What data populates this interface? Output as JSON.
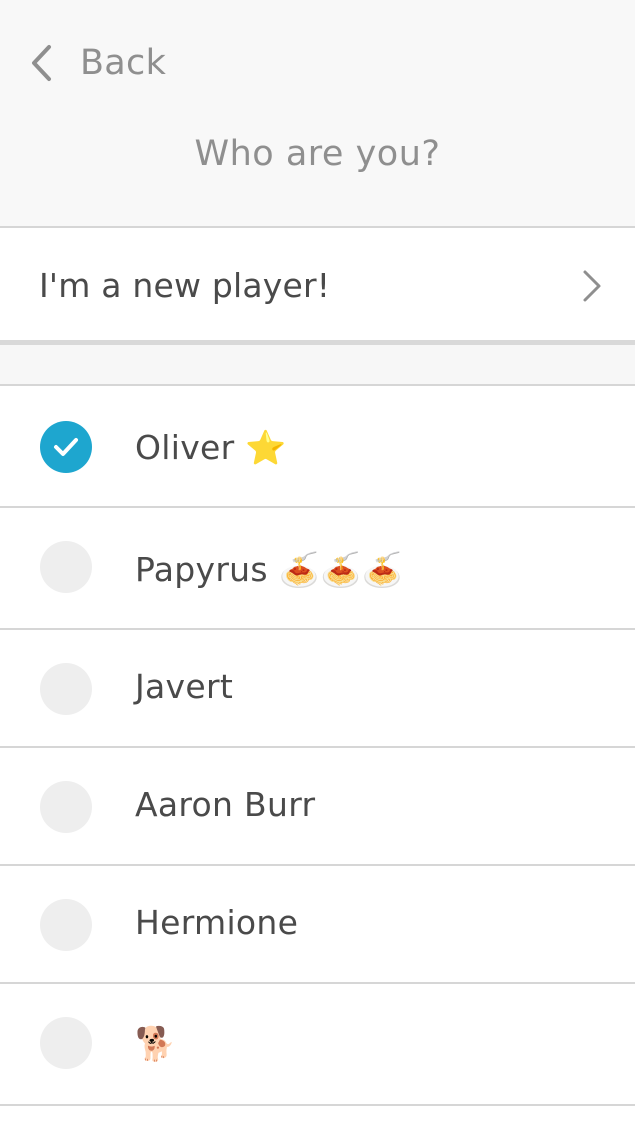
{
  "header": {
    "back_label": "Back",
    "title": "Who are you?",
    "back_icon": "chevron-left-icon"
  },
  "new_player": {
    "label": "I'm a new player!",
    "icon": "chevron-right-icon"
  },
  "players": [
    {
      "name": "Oliver ⭐",
      "selected": true
    },
    {
      "name": "Papyrus 🍝🍝🍝",
      "selected": false
    },
    {
      "name": "Javert",
      "selected": false
    },
    {
      "name": "Aaron Burr",
      "selected": false
    },
    {
      "name": "Hermione",
      "selected": false
    },
    {
      "name": "🐕",
      "selected": false
    }
  ],
  "colors": {
    "accent": "#1ea6cf",
    "header_bg": "#f8f8f8",
    "muted_text": "#8f8f8f",
    "text": "#4a4a4a",
    "divider": "#d6d6d6",
    "radio_unselected": "#eeeeee"
  }
}
